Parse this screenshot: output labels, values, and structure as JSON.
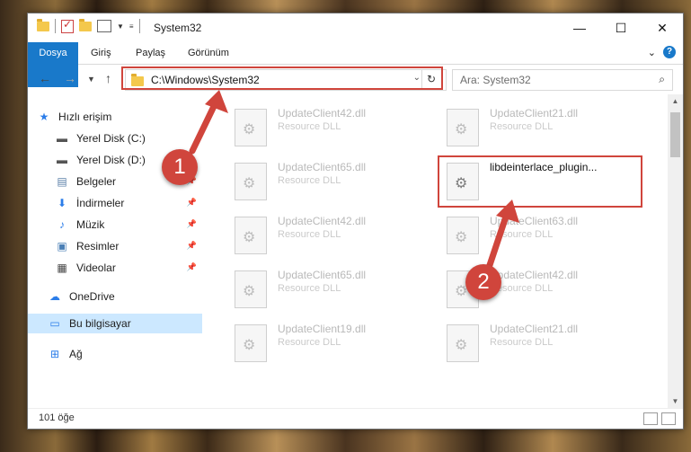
{
  "window": {
    "title": "System32"
  },
  "window_buttons": {
    "minimize": "—",
    "maximize": "☐",
    "close": "✕"
  },
  "ribbon": {
    "tabs": [
      {
        "label": "Dosya"
      },
      {
        "label": "Giriş"
      },
      {
        "label": "Paylaş"
      },
      {
        "label": "Görünüm"
      }
    ],
    "help": "?"
  },
  "address": {
    "path": "C:\\Windows\\System32",
    "search_placeholder": "Ara: System32"
  },
  "sidebar": {
    "items": [
      {
        "label": "Hızlı erişim"
      },
      {
        "label": "Yerel Disk (C:)"
      },
      {
        "label": "Yerel Disk (D:)"
      },
      {
        "label": "Belgeler"
      },
      {
        "label": "İndirmeler"
      },
      {
        "label": "Müzik"
      },
      {
        "label": "Resimler"
      },
      {
        "label": "Videolar"
      },
      {
        "label": "OneDrive"
      },
      {
        "label": "Bu bilgisayar"
      },
      {
        "label": "Ağ"
      }
    ]
  },
  "files": [
    {
      "name": "UpdateClient42.dll",
      "type": "Resource DLL"
    },
    {
      "name": "UpdateClient21.dll",
      "type": "Resource DLL"
    },
    {
      "name": "UpdateClient65.dll",
      "type": "Resource DLL"
    },
    {
      "name": "libdeinterlace_plugin...",
      "type": ""
    },
    {
      "name": "UpdateClient42.dll",
      "type": "Resource DLL"
    },
    {
      "name": "UpdateClient63.dll",
      "type": "Resource DLL"
    },
    {
      "name": "UpdateClient65.dll",
      "type": "Resource DLL"
    },
    {
      "name": "UpdateClient42.dll",
      "type": "Resource DLL"
    },
    {
      "name": "UpdateClient19.dll",
      "type": "Resource DLL"
    },
    {
      "name": "UpdateClient21.dll",
      "type": "Resource DLL"
    }
  ],
  "status": {
    "count": "101 öğe"
  },
  "annotations": {
    "step1": "1",
    "step2": "2",
    "accent": "#d0453c"
  }
}
